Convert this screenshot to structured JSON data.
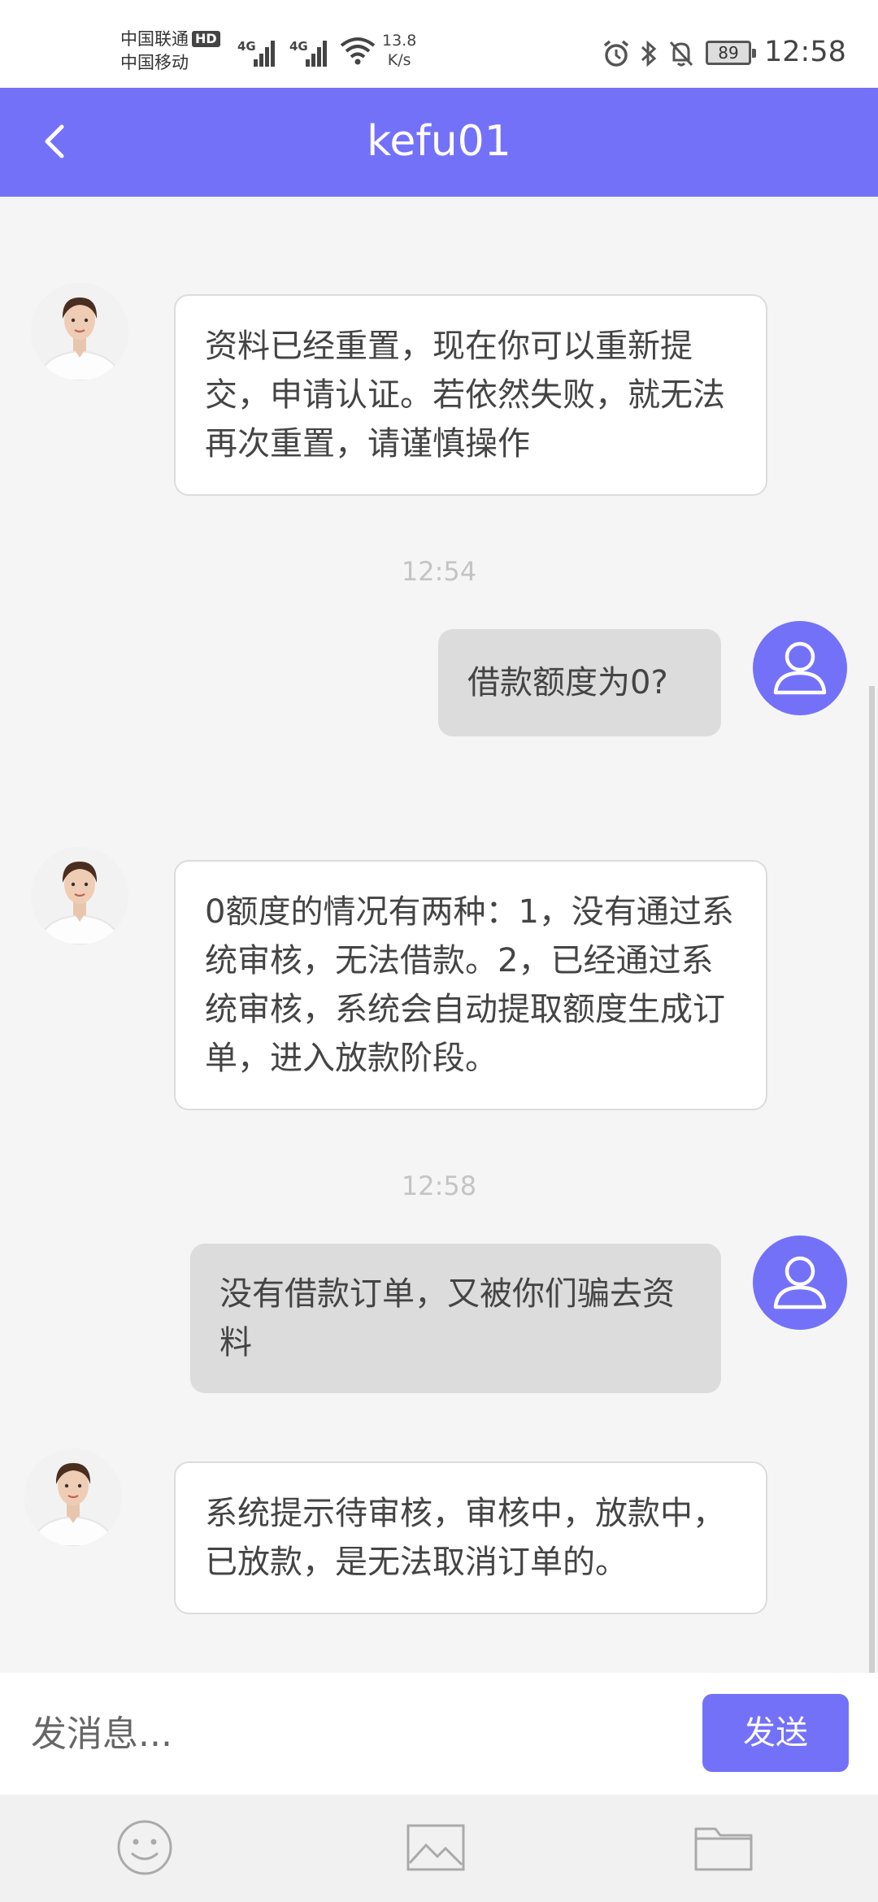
{
  "status_bar": {
    "carrier_1": "中国联通",
    "hd": "HD",
    "carrier_2": "中国移动",
    "network_1": "4G",
    "network_2": "4G",
    "speed_value": "13.8",
    "speed_unit": "K/s",
    "battery": "89",
    "time": "12:58",
    "icons": [
      "alarm-icon",
      "bluetooth-icon",
      "mute-icon"
    ]
  },
  "header": {
    "title": "kefu01",
    "back_icon": "chevron-left-icon"
  },
  "messages": [
    {
      "sender": "agent",
      "text": "资料已经重置，现在你可以重新提交，申请认证。若依然失败，就无法再次重置，请谨慎操作"
    },
    {
      "timestamp": "12:54"
    },
    {
      "sender": "user",
      "text": "借款额度为0?"
    },
    {
      "sender": "agent",
      "text": "0额度的情况有两种：1，没有通过系统审核，无法借款。2，已经通过系统审核，系统会自动提取额度生成订单，进入放款阶段。"
    },
    {
      "timestamp": "12:58"
    },
    {
      "sender": "user",
      "text": "没有借款订单，又被你们骗去资料"
    },
    {
      "sender": "agent",
      "text": "系统提示待审核，审核中，放款中，已放款，是无法取消订单的。"
    }
  ],
  "input": {
    "placeholder": "发消息...",
    "value": "",
    "send_label": "发送"
  },
  "toolbar": {
    "icons": [
      "emoji-icon",
      "image-icon",
      "folder-icon"
    ]
  },
  "colors": {
    "accent": "#7471f9",
    "user_bubble": "#dcdcdc",
    "background": "#f5f5f5"
  }
}
